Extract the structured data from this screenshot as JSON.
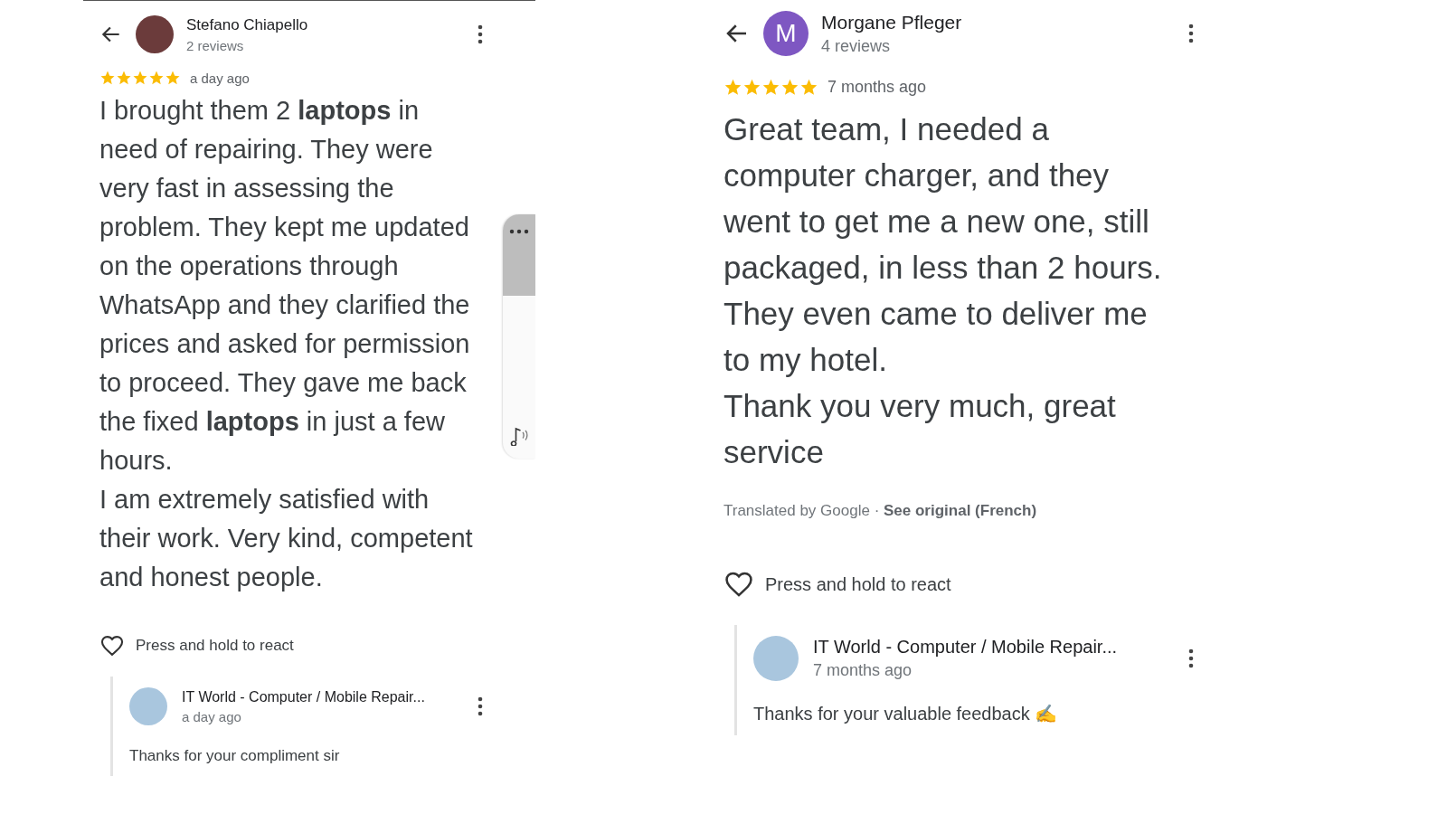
{
  "panels": [
    {
      "kind": "compact",
      "reviewer": {
        "name": "Stefano Chiapello",
        "count": "2 reviews",
        "avatar": {
          "kind": "photo"
        }
      },
      "stars": 5,
      "time": "a day ago",
      "paragraphs": [
        "I brought them 2 **laptops** in need of repairing. They were very fast in assessing the problem. They kept me updated on the operations through WhatsApp and they clarified the prices and asked for permission to proceed. They gave me back the fixed **laptops** in just a few hours.",
        "I am extremely satisfied with their work. Very kind, competent and honest people."
      ],
      "react": "Press and hold to react",
      "reply": {
        "name": "IT World - Computer / Mobile Repair...",
        "time": "a day ago",
        "text": "Thanks for your compliment sir"
      },
      "floating_widget": true
    },
    {
      "kind": "expanded",
      "reviewer": {
        "name": "Morgane Pfleger",
        "count": "4 reviews",
        "avatar": {
          "kind": "letter",
          "letter": "M"
        }
      },
      "stars": 5,
      "time": "7 months ago",
      "paragraphs": [
        "Great team, I needed a computer charger, and they went to get me a new one, still packaged, in less than 2 hours.",
        "They even came to deliver me to my hotel.",
        "Thank you very much, great service"
      ],
      "translation": {
        "note": "Translated by Google · ",
        "link": "See original (French)"
      },
      "react": "Press and hold to react",
      "reply": {
        "name": "IT World - Computer / Mobile Repair...",
        "time": "7 months ago",
        "text": "Thanks for your valuable feedback ✍"
      },
      "floating_widget": false
    }
  ]
}
